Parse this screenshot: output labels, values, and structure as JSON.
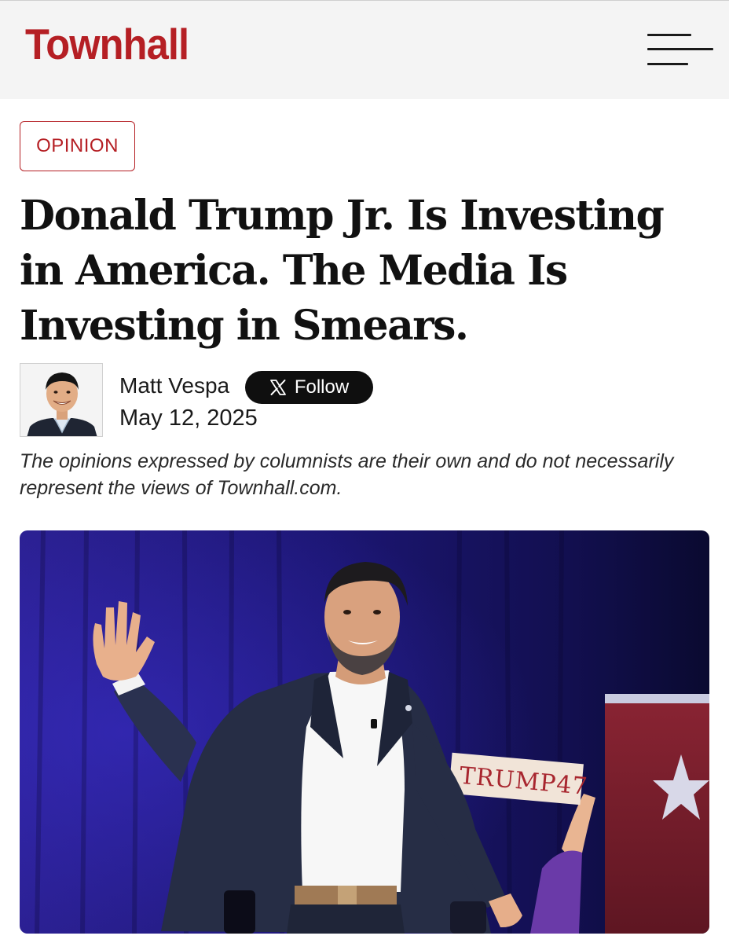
{
  "site": {
    "logo_text": "Townhall",
    "brand_color": "#b51f24",
    "menu_icon": "hamburger-menu-icon"
  },
  "article": {
    "section": "OPINION",
    "headline": "Donald Trump Jr. Is Investing in America. The Media Is Investing in Smears.",
    "author": {
      "name": "Matt Vespa",
      "follow_label": "Follow",
      "follow_icon": "x-logo-icon"
    },
    "date": "May 12, 2025",
    "disclaimer": "The opinions expressed by columnists are their own and do not necessarily represent the views of Townhall.com.",
    "hero_image": {
      "sign_text": "TRUMP47"
    }
  }
}
